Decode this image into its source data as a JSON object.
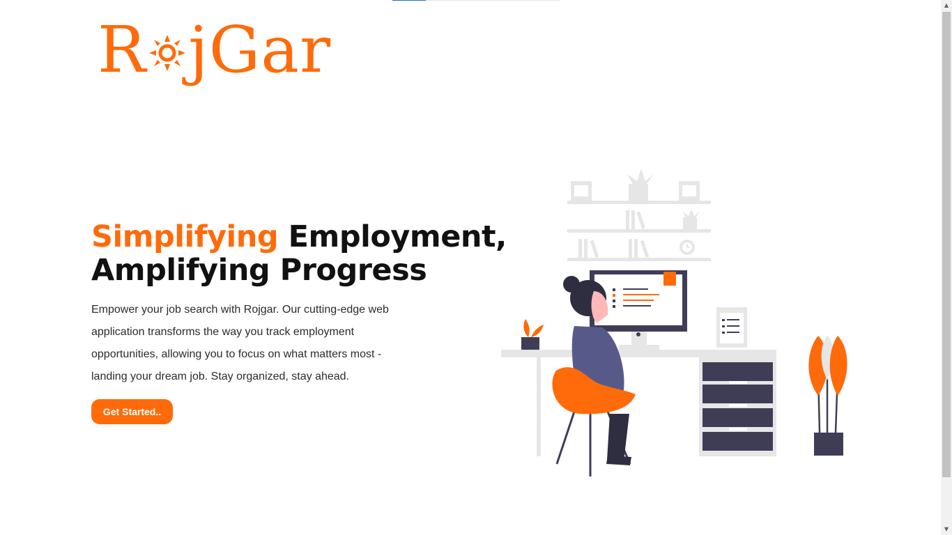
{
  "loader": {
    "progress": 0.2
  },
  "brand": {
    "logo_text": "RojGar",
    "color": "#ff6b0a"
  },
  "hero": {
    "title_accent": "Simplifying",
    "title_rest": "Employment,",
    "title_line2": "Amplifying Progress",
    "description": "Empower your job search with Rojgar. Our cutting-edge web application transforms the way you track employment opportunities, allowing you to focus on what matters most - landing your dream job. Stay organized, stay ahead.",
    "cta_label": "Get Started.."
  },
  "illustration": {
    "name": "woman-working-at-desk-illustration"
  }
}
